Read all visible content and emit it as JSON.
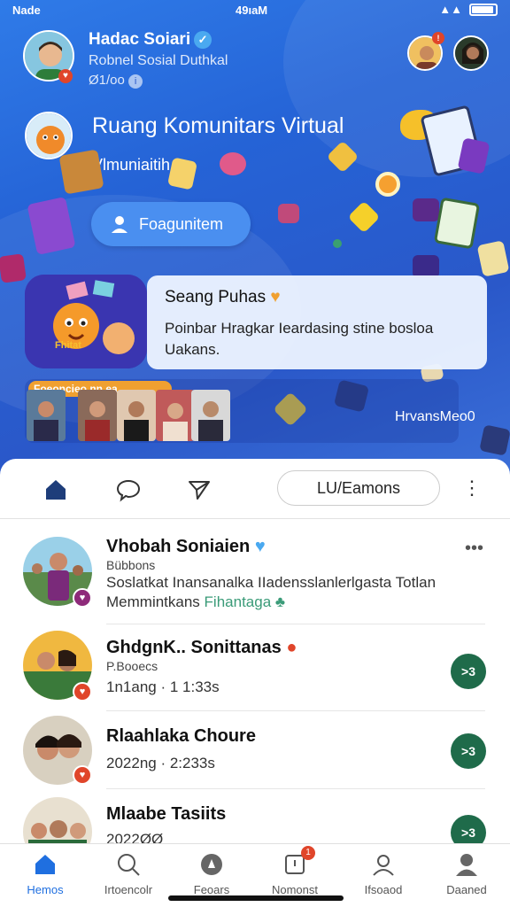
{
  "status_bar": {
    "carrier": "Nade",
    "time": "49ıaM"
  },
  "profile": {
    "name": "Hadac Soiari",
    "subtitle": "Robnel Sosial Duthkal",
    "meta": "Ø1/oo"
  },
  "hero": {
    "title": "Ruang Komunitars Virtual",
    "subtitle": "Vlmuniaitih",
    "join_button": "Foagunitem"
  },
  "featured": {
    "card_label": "Fhitat",
    "bubble_title": "Seang Puhas",
    "bubble_body": "Poinbar Hragkar Ieardasing stine bosloa Uakans."
  },
  "strip": {
    "label": "Foeoncieo nn ea",
    "caption": "HrvansMeo0"
  },
  "toolbar": {
    "filter_label": "LU/Eamons"
  },
  "feed": [
    {
      "name": "Vhobah Soniaien",
      "small": "Bübbons",
      "line1": "Soslatkat Inansanalka IIadensslanlerlgasta Totlan",
      "line2_prefix": "Memmintkans",
      "line2_accent": "Fihantaga",
      "badge_color": "#8e2a7a"
    },
    {
      "name": "GhdgnK.. Sonittanas",
      "small": "P.Booecs",
      "line1": "1n1ang · 1 1:33s",
      "action": ">3",
      "badge_color": "#e0452a"
    },
    {
      "name": "Rlaahlaka Choure",
      "line1": "2022ng · 2:233s",
      "action": ">3",
      "badge_color": "#e0452a"
    },
    {
      "name": "Mlaabe Tasiits",
      "line1": "2022ØØ",
      "action": ">3"
    }
  ],
  "bottom_nav": [
    {
      "label": "Hemos",
      "icon": "home-icon",
      "active": true
    },
    {
      "label": "Irtoencolr",
      "icon": "search-icon"
    },
    {
      "label": "Feoars",
      "icon": "compass-icon"
    },
    {
      "label": "Nomonst",
      "icon": "notification-icon",
      "badge": "1"
    },
    {
      "label": "Ifsoaod",
      "icon": "profile-outline-icon"
    },
    {
      "label": "Daaned",
      "icon": "account-icon"
    }
  ],
  "colors": {
    "hero_blue": "#2563d6",
    "accent_blue": "#1f6fe0",
    "action_green": "#1f6b4a",
    "badge_red": "#e0452a"
  }
}
